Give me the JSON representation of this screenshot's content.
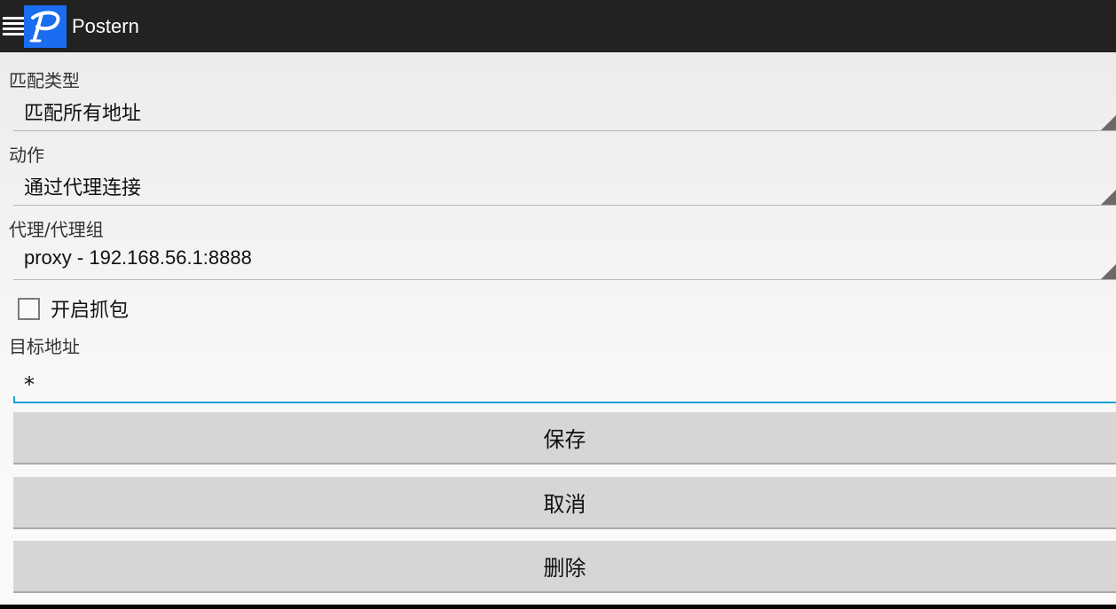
{
  "app": {
    "title": "Postern",
    "logo_letter": "P",
    "colors": {
      "action_bar": "#222222",
      "logo_bg": "#1a6cf0",
      "input_accent": "#1f9fd4",
      "button_bg": "#d6d6d6"
    }
  },
  "form": {
    "match_type": {
      "label": "匹配类型",
      "value": "匹配所有地址"
    },
    "action": {
      "label": "动作",
      "value": "通过代理连接"
    },
    "proxy": {
      "label": "代理/代理组",
      "value": "proxy - 192.168.56.1:8888"
    },
    "capture": {
      "label": "开启抓包",
      "checked": false
    },
    "target": {
      "label": "目标地址",
      "value": "*"
    }
  },
  "buttons": {
    "save": "保存",
    "cancel": "取消",
    "delete": "删除"
  },
  "icons": {
    "menu": "hamburger-menu-icon",
    "logo": "postern-logo-icon",
    "dropdown": "spinner-corner-icon"
  }
}
